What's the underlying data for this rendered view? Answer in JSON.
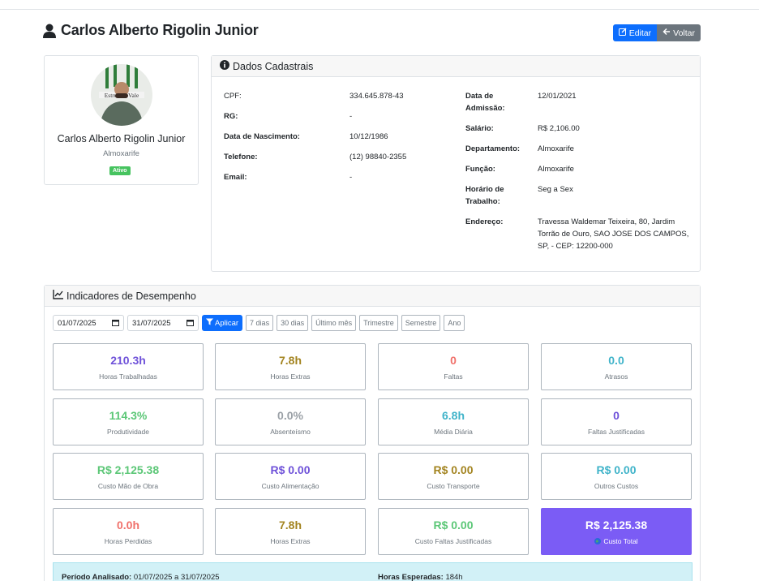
{
  "header": {
    "title": "Carlos Alberto Rigolin Junior",
    "edit_label": "Editar",
    "back_label": "Voltar"
  },
  "profile": {
    "name": "Carlos Alberto Rigolin Junior",
    "role": "Almoxarife",
    "status": "Ativo",
    "avatar_text": "Estrutura Vale"
  },
  "info": {
    "title": "Dados Cadastrais",
    "left": [
      {
        "label": "CPF:",
        "value": "334.645.878-43"
      },
      {
        "label": "RG:",
        "value": "-"
      },
      {
        "label": "Data de Nascimento:",
        "value": "10/12/1986"
      },
      {
        "label": "Telefone:",
        "value": "(12) 98840-2355"
      },
      {
        "label": "Email:",
        "value": "-"
      }
    ],
    "right": [
      {
        "label": "Data de Admissão:",
        "value": "12/01/2021"
      },
      {
        "label": "Salário:",
        "value": "R$ 2,106.00"
      },
      {
        "label": "Departamento:",
        "value": "Almoxarife"
      },
      {
        "label": "Função:",
        "value": "Almoxarife"
      },
      {
        "label": "Horário de Trabalho:",
        "value": "Seg a Sex"
      },
      {
        "label": "Endereço:",
        "value": "Travessa Waldemar Teixeira, 80, Jardim Torrão de Ouro, SAO JOSE DOS CAMPOS, SP, - CEP: 12200-000"
      }
    ]
  },
  "performance": {
    "title": "Indicadores de Desempenho",
    "date_from": "01/07/2025",
    "date_to": "31/07/2025",
    "apply_label": "Aplicar",
    "presets": [
      "7 dias",
      "30 dias",
      "Último mês",
      "Trimestre",
      "Semestre",
      "Ano"
    ],
    "metrics": [
      {
        "value": "210.3h",
        "label": "Horas Trabalhadas",
        "color": "#6f52d9"
      },
      {
        "value": "7.8h",
        "label": "Horas Extras",
        "color": "#a38420"
      },
      {
        "value": "0",
        "label": "Faltas",
        "color": "#f0706a"
      },
      {
        "value": "0.0",
        "label": "Atrasos",
        "color": "#3fb3c9"
      },
      {
        "value": "114.3%",
        "label": "Produtividade",
        "color": "#5cc777"
      },
      {
        "value": "0.0%",
        "label": "Absenteísmo",
        "color": "#9aa0a6"
      },
      {
        "value": "6.8h",
        "label": "Média Diária",
        "color": "#3fb3c9"
      },
      {
        "value": "0",
        "label": "Faltas Justificadas",
        "color": "#6f52d9"
      },
      {
        "value": "R$ 2,125.38",
        "label": "Custo Mão de Obra",
        "color": "#5cc777"
      },
      {
        "value": "R$ 0.00",
        "label": "Custo Alimentação",
        "color": "#6f52d9"
      },
      {
        "value": "R$ 0.00",
        "label": "Custo Transporte",
        "color": "#a38420"
      },
      {
        "value": "R$ 0.00",
        "label": "Outros Custos",
        "color": "#3fb3c9"
      },
      {
        "value": "0.0h",
        "label": "Horas Perdidas",
        "color": "#f0706a"
      },
      {
        "value": "7.8h",
        "label": "Horas Extras",
        "color": "#a38420"
      },
      {
        "value": "R$ 0.00",
        "label": "Custo Faltas Justificadas",
        "color": "#5cc777"
      },
      {
        "value": "R$ 2,125.38",
        "label": "Custo Total",
        "color": "#ffffff"
      }
    ],
    "summary": {
      "period_label": "Período Analisado:",
      "period_value": "01/07/2025 a 31/07/2025",
      "expected_label": "Horas Esperadas:",
      "expected_value": "184h"
    }
  }
}
